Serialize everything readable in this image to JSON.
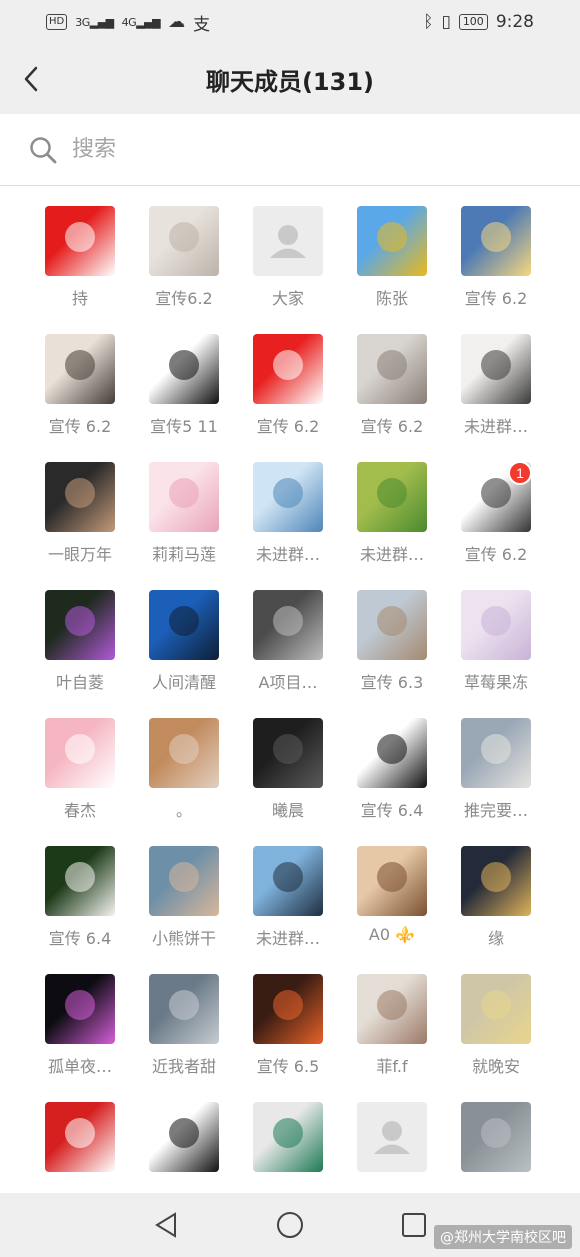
{
  "status_bar": {
    "chip": "HD",
    "network1": "3G",
    "network2": "4G",
    "battery": "100",
    "time": "9:28"
  },
  "header": {
    "title": "聊天成员(131)",
    "back_icon": "chevron-left-icon"
  },
  "search": {
    "placeholder": "搜索",
    "icon": "search-icon"
  },
  "members": [
    {
      "name": "持",
      "colors": [
        "#e51c1c",
        "#ffffff"
      ]
    },
    {
      "name": "宣传6.2",
      "colors": [
        "#e7e2dc",
        "#bdb3aa"
      ]
    },
    {
      "name": "大家",
      "colors": [
        "#ececec",
        "#c9c9c9"
      ],
      "default": true
    },
    {
      "name": "陈张",
      "colors": [
        "#5aa8e8",
        "#e9b91d"
      ]
    },
    {
      "name": "宣传 6.2",
      "colors": [
        "#4d7ab4",
        "#f6d780"
      ]
    },
    {
      "name": "宣传 6.2",
      "colors": [
        "#e9e1d8",
        "#453c37"
      ]
    },
    {
      "name": "宣传5 11",
      "colors": [
        "#ffffff",
        "#111111"
      ]
    },
    {
      "name": "宣传 6.2",
      "colors": [
        "#e8201f",
        "#ffffff"
      ]
    },
    {
      "name": "宣传 6.2",
      "colors": [
        "#d8d4cf",
        "#8a7e76"
      ]
    },
    {
      "name": "未进群…",
      "colors": [
        "#f2f0ee",
        "#3b3b3b"
      ]
    },
    {
      "name": "一眼万年",
      "colors": [
        "#2a2a2a",
        "#c49a7a"
      ]
    },
    {
      "name": "莉莉马莲",
      "colors": [
        "#fbe3ea",
        "#e9a3b8"
      ]
    },
    {
      "name": "未进群…",
      "colors": [
        "#cfe4f4",
        "#4f86b8"
      ]
    },
    {
      "name": "未进群…",
      "colors": [
        "#a3bd4d",
        "#4b8a2f"
      ]
    },
    {
      "name": "宣传 6.2",
      "colors": [
        "#ffffff",
        "#333333"
      ],
      "badge": "1"
    },
    {
      "name": "叶自菱",
      "colors": [
        "#1f2a1f",
        "#b35ad8"
      ]
    },
    {
      "name": "人间清醒",
      "colors": [
        "#1c5fb8",
        "#0e1f36"
      ]
    },
    {
      "name": "A项目…",
      "colors": [
        "#4c4c4c",
        "#bdbdbd"
      ]
    },
    {
      "name": "宣传  6.3",
      "colors": [
        "#bfc9d4",
        "#a58a70"
      ]
    },
    {
      "name": "草莓果冻",
      "colors": [
        "#ece3ef",
        "#c9b3d8"
      ]
    },
    {
      "name": "春杰",
      "colors": [
        "#f6b6c1",
        "#ffffff"
      ]
    },
    {
      "name": "。",
      "colors": [
        "#c28b5e",
        "#e2cfbf"
      ]
    },
    {
      "name": "曦晨",
      "colors": [
        "#1e1e1e",
        "#5a5a5a"
      ]
    },
    {
      "name": "宣传 6.4",
      "colors": [
        "#ffffff",
        "#111111"
      ]
    },
    {
      "name": "推完要…",
      "colors": [
        "#9aa8b6",
        "#e6e3df"
      ]
    },
    {
      "name": "宣传 6.4",
      "colors": [
        "#1d3a18",
        "#f4f4f0"
      ]
    },
    {
      "name": "小熊饼干",
      "colors": [
        "#6d8fa8",
        "#d9b79a"
      ]
    },
    {
      "name": "未进群…",
      "colors": [
        "#7fb2dc",
        "#1f2f40"
      ]
    },
    {
      "name": "A0 ⚜️",
      "colors": [
        "#e6c8a7",
        "#7a5031"
      ]
    },
    {
      "name": "缘",
      "colors": [
        "#232a3a",
        "#e0b35a"
      ]
    },
    {
      "name": "孤单夜…",
      "colors": [
        "#0c0c12",
        "#d65fd8"
      ]
    },
    {
      "name": "近我者甜",
      "colors": [
        "#6a7a88",
        "#c7ccd1"
      ]
    },
    {
      "name": "宣传 6.5",
      "colors": [
        "#3a1d12",
        "#e8622b"
      ]
    },
    {
      "name": "菲f.f",
      "colors": [
        "#e4ddd6",
        "#9b7a66"
      ]
    },
    {
      "name": "就晚安",
      "colors": [
        "#cfc6a8",
        "#e8d58b"
      ]
    },
    {
      "name": "",
      "colors": [
        "#d62020",
        "#ffffff"
      ]
    },
    {
      "name": "",
      "colors": [
        "#ffffff",
        "#111111"
      ]
    },
    {
      "name": "",
      "colors": [
        "#e8e8e8",
        "#1d7a55"
      ]
    },
    {
      "name": "",
      "colors": [
        "#ececec",
        "#c9c9c9"
      ],
      "default": true
    },
    {
      "name": "",
      "colors": [
        "#8a9196",
        "#b9c0c4"
      ]
    }
  ],
  "nav": {
    "back": "triangle-back-icon",
    "home": "circle-home-icon",
    "recent": "square-recent-icon"
  },
  "watermark": "@郑州大学南校区吧"
}
